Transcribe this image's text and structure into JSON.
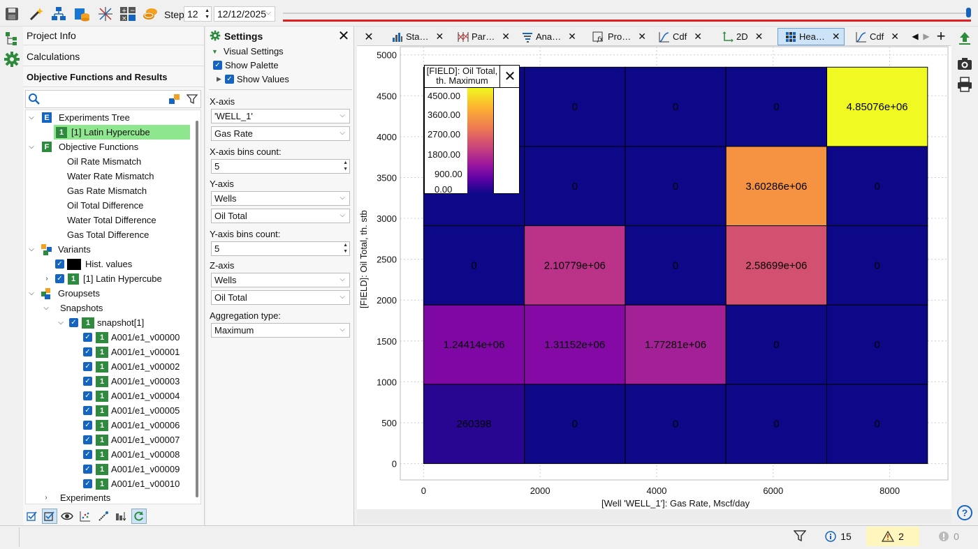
{
  "toolbar": {
    "step_label": "Step:",
    "step_value": "12",
    "date_value": "12/12/2025",
    "icons": [
      "save-icon",
      "magic-wand-icon",
      "structure-icon",
      "database-icon",
      "network-icon",
      "calculator-icon",
      "coins-icon"
    ]
  },
  "left_panel": {
    "sections": [
      "Project Info",
      "Calculations",
      "Objective Functions and Results"
    ],
    "search_placeholder": "",
    "tree": {
      "experiments_tree": "Experiments Tree",
      "latin_hypercube": "[1] Latin Hypercube",
      "objective_functions": "Objective Functions",
      "objectives": [
        "Oil Rate Mismatch",
        "Water Rate Mismatch",
        "Gas Rate Mismatch",
        "Oil Total Difference",
        "Water Total Difference",
        "Gas Total Difference"
      ],
      "variants": "Variants",
      "hist_values": "Hist. values",
      "variant_latin": "[1] Latin Hypercube",
      "groupsets": "Groupsets",
      "snapshots": "Snapshots",
      "snapshot": "snapshot[1]",
      "items": [
        "A001/e1_v00000",
        "A001/e1_v00001",
        "A001/e1_v00002",
        "A001/e1_v00003",
        "A001/e1_v00004",
        "A001/e1_v00005",
        "A001/e1_v00006",
        "A001/e1_v00007",
        "A001/e1_v00008",
        "A001/e1_v00009",
        "A001/e1_v00010"
      ],
      "experiments": "Experiments",
      "badge": "1",
      "e_badge": "E",
      "f_badge": "F"
    }
  },
  "settings": {
    "title": "Settings",
    "visual_settings": "Visual Settings",
    "show_palette": "Show Palette",
    "show_values": "Show Values",
    "x_axis_label": "X-axis",
    "x_axis_object": "'WELL_1'",
    "x_axis_param": "Gas Rate",
    "x_bins_label": "X-axis bins count:",
    "x_bins": "5",
    "y_axis_label": "Y-axis",
    "y_axis_object": "Wells",
    "y_axis_param": "Oil Total",
    "y_bins_label": "Y-axis bins count:",
    "y_bins": "5",
    "z_axis_label": "Z-axis",
    "z_axis_object": "Wells",
    "z_axis_param": "Oil Total",
    "agg_label": "Aggregation type:",
    "agg_value": "Maximum"
  },
  "tabs": [
    {
      "label": "Sta…",
      "icon": "bar-chart-icon"
    },
    {
      "label": "Par…",
      "icon": "parallel-coordinates-icon"
    },
    {
      "label": "Ana…",
      "icon": "tornado-chart-icon"
    },
    {
      "label": "Pro…",
      "icon": "function-icon"
    },
    {
      "label": "Cdf",
      "icon": "cdf-curve-icon"
    },
    {
      "label": "2D",
      "icon": "axes-2d-icon"
    },
    {
      "label": "Hea…",
      "icon": "heatmap-icon",
      "active": true
    },
    {
      "label": "Cdf",
      "icon": "cdf-curve-icon"
    }
  ],
  "status": {
    "info_count": "15",
    "warning_count": "2",
    "error_count": "0"
  },
  "colors": {
    "accent": "#1565c0",
    "green": "#2e8b3e",
    "active_tab": "#cde3f7"
  },
  "chart_data": {
    "type": "heatmap",
    "xlabel": "[Well 'WELL_1']: Gas Rate, Mscf/day",
    "ylabel": "[FIELD]: Oil Total, th. stb",
    "x_ticks": [
      0,
      2000,
      4000,
      6000,
      8000
    ],
    "y_ticks": [
      0,
      500,
      1000,
      1500,
      2000,
      2500,
      3000,
      3500,
      4000,
      4500,
      5000
    ],
    "xlim": [
      -400,
      9000
    ],
    "ylim": [
      -200,
      5100
    ],
    "x_bin_edges": [
      0,
      1730,
      3460,
      5190,
      6920,
      8650
    ],
    "y_bin_edges": [
      0,
      970,
      1940,
      2910,
      3880,
      4850
    ],
    "rows_top_to_bottom": [
      [
        "",
        "0",
        "0",
        "0",
        "4.85076e+06"
      ],
      [
        "",
        "0",
        "0",
        "3.60286e+06",
        "0"
      ],
      [
        "0",
        "2.10779e+06",
        "0",
        "2.58699e+06",
        "0"
      ],
      [
        "1.24414e+06",
        "1.31152e+06",
        "1.77281e+06",
        "0",
        "0"
      ],
      [
        "260398",
        "0",
        "0",
        "0",
        "0"
      ]
    ],
    "values_top_to_bottom": [
      [
        0,
        0,
        0,
        0,
        4850.76
      ],
      [
        0,
        0,
        0,
        3602.86,
        0
      ],
      [
        0,
        2107.79,
        0,
        2586.99,
        0
      ],
      [
        1244.14,
        1311.52,
        1772.81,
        0,
        0
      ],
      [
        260.398,
        0,
        0,
        0,
        0
      ]
    ],
    "z_range": [
      0,
      4850.76
    ],
    "colormap": "plasma",
    "legend": {
      "title_line1": "[FIELD]: Oil Total,",
      "title_line2": "th. Maximum",
      "ticks": [
        "4500.00",
        "3600.00",
        "2700.00",
        "1800.00",
        "900.00",
        "0.00"
      ],
      "placement": "top-left"
    },
    "grid": true
  }
}
